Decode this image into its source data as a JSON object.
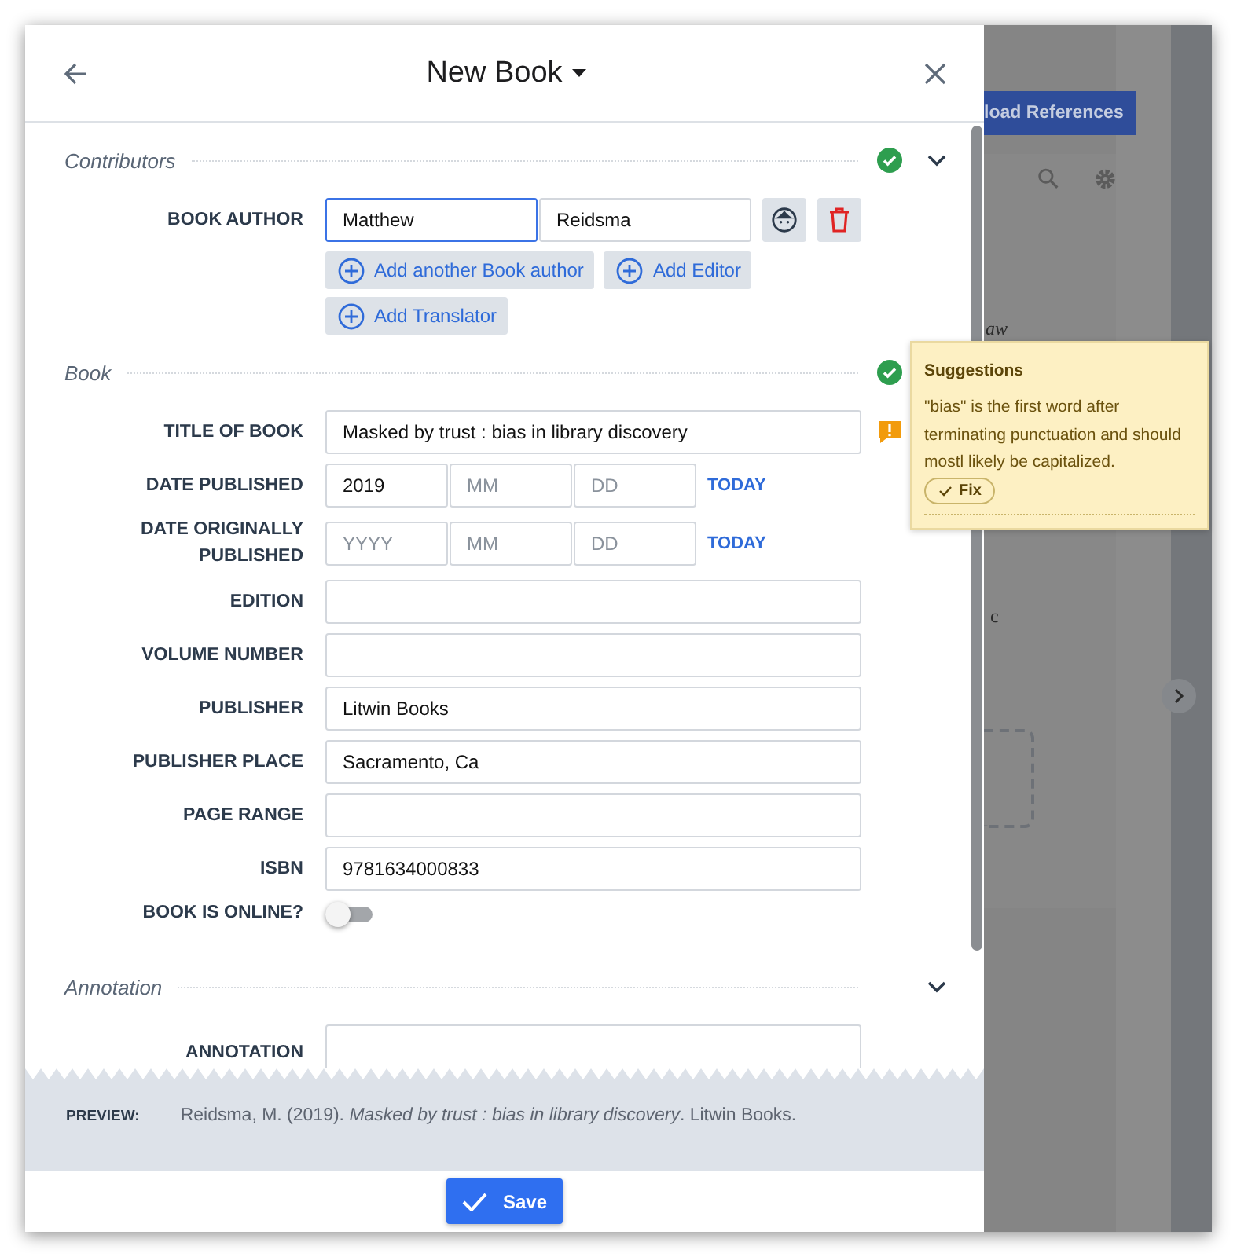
{
  "header": {
    "title": "New Book"
  },
  "contributors": {
    "title": "Contributors",
    "complete": true,
    "collapsible": true,
    "rows": [
      {
        "label": "BOOK AUTHOR",
        "fields": [
          {
            "value": "Matthew",
            "focused": true
          },
          {
            "value": "Reidsma",
            "focused": false
          }
        ]
      }
    ],
    "add_buttons": [
      "Add another Book author",
      "Add Editor",
      "Add Translator"
    ]
  },
  "book": {
    "title": "Book",
    "complete": true,
    "collapsible": false,
    "fields": [
      {
        "kind": "text",
        "label": "TITLE OF BOOK",
        "value": "Masked by trust : bias in library discovery",
        "warning": true
      },
      {
        "kind": "date",
        "label": "DATE PUBLISHED",
        "parts": [
          {
            "value": "2019"
          },
          {
            "placeholder": "MM"
          },
          {
            "placeholder": "DD"
          }
        ],
        "action": "TODAY"
      },
      {
        "kind": "date",
        "label": "DATE ORIGINALLY PUBLISHED",
        "parts": [
          {
            "placeholder": "YYYY"
          },
          {
            "placeholder": "MM"
          },
          {
            "placeholder": "DD"
          }
        ],
        "action": "TODAY"
      },
      {
        "kind": "text",
        "label": "EDITION",
        "warning": false
      },
      {
        "kind": "text",
        "label": "VOLUME NUMBER",
        "warning": false
      },
      {
        "kind": "text",
        "label": "PUBLISHER",
        "value": "Litwin Books",
        "warning": false
      },
      {
        "kind": "text",
        "label": "PUBLISHER PLACE",
        "value": "Sacramento, Ca",
        "warning": false
      },
      {
        "kind": "text",
        "label": "PAGE RANGE",
        "warning": false
      },
      {
        "kind": "text",
        "label": "ISBN",
        "value": "9781634000833",
        "warning": false
      },
      {
        "kind": "toggle",
        "label": "BOOK IS ONLINE?",
        "on": false
      }
    ]
  },
  "annotation": {
    "title": "Annotation",
    "complete": false,
    "collapsible": true,
    "label": "ANNOTATION"
  },
  "preview": {
    "label": "PREVIEW:",
    "citation": "Reidsma, M. (2019). *Masked by trust : bias in library discovery*. Litwin Books."
  },
  "save_button": "Save",
  "suggestion": {
    "title": "Suggestions",
    "message": "\"bias\" is the first word after terminating punctuation and should mostl likely be capitalized.",
    "fix_button": "Fix"
  },
  "background": {
    "button": "load References",
    "fragments": [
      "aw",
      "c"
    ]
  }
}
